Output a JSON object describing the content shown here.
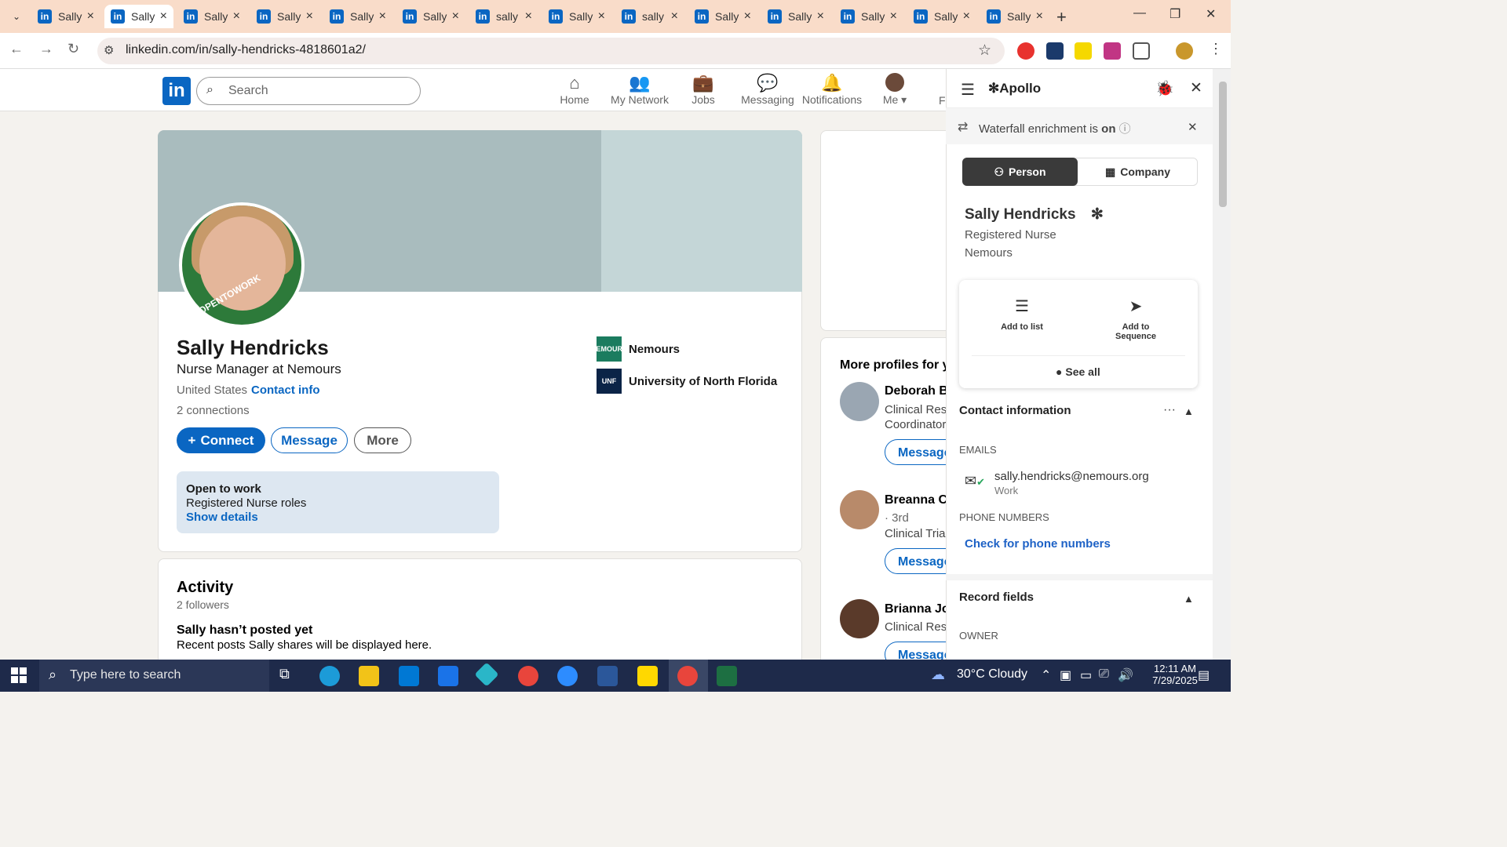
{
  "browser": {
    "tabs": [
      {
        "label": "Sally"
      },
      {
        "label": "Sally",
        "active": true
      },
      {
        "label": "Sally"
      },
      {
        "label": "Sally"
      },
      {
        "label": "Sally"
      },
      {
        "label": "Sally"
      },
      {
        "label": "sally"
      },
      {
        "label": "Sally"
      },
      {
        "label": "sally"
      },
      {
        "label": "Sally"
      },
      {
        "label": "Sally"
      },
      {
        "label": "Sally"
      },
      {
        "label": "Sally"
      },
      {
        "label": "Sally"
      }
    ],
    "url": "linkedin.com/in/sally-hendricks-4818601a2/",
    "colors": {
      "tabbar": "#f9dcc9",
      "linkedin_blue": "#0a66c2"
    }
  },
  "linkedin": {
    "logo": "in",
    "search_placeholder": "Search",
    "nav": [
      "Home",
      "My Network",
      "Jobs",
      "Messaging",
      "Notifications",
      "Me",
      "Fo"
    ],
    "profile": {
      "name": "Sally Hendricks",
      "headline": "Nurse Manager at Nemours",
      "location": "United States",
      "contact_info": "Contact info",
      "connections": "2 connections",
      "open_to_work_badge": "#OPENTOWORK",
      "buttons": {
        "connect": "Connect",
        "message": "Message",
        "more": "More"
      },
      "open_to_work": {
        "title": "Open to work",
        "roles": "Registered Nurse roles",
        "link": "Show details"
      },
      "orgs": [
        {
          "name": "Nemours",
          "logo_text": "NEMOURS"
        },
        {
          "name": "University of North Florida",
          "logo_text": "UNF"
        }
      ]
    },
    "activity": {
      "title": "Activity",
      "followers": "2 followers",
      "no_posts": "Sally hasn’t posted yet",
      "recent_posts": "Recent posts Sally shares will be displayed here."
    },
    "more_profiles": {
      "title": "More profiles for y",
      "items": [
        {
          "name": "Deborah B",
          "degree": "",
          "sub1": "Clinical Rese",
          "sub2": "Coordinator",
          "action": "Message"
        },
        {
          "name": "Breanna Ca",
          "degree": "· 3rd",
          "sub1": "Clinical Trials",
          "sub2": "",
          "action": "Message"
        },
        {
          "name": "Brianna Jo",
          "degree": "",
          "sub1": "Clinical Rese",
          "sub2": "",
          "action": "Message"
        }
      ]
    }
  },
  "apollo": {
    "brand": "Apollo",
    "waterfall_prefix": "Waterfall enrichment is",
    "waterfall_state": "on",
    "tabs": {
      "person": "Person",
      "company": "Company"
    },
    "person": {
      "name": "Sally Hendricks",
      "title": "Registered Nurse",
      "company": "Nemours"
    },
    "actions": {
      "add_to_list": "Add to list",
      "add_to_sequence_1": "Add to",
      "add_to_sequence_2": "Sequence",
      "see_all": "See all"
    },
    "contact_information": "Contact information",
    "emails_label": "EMAILS",
    "email": "sally.hendricks@nemours.org",
    "email_type": "Work",
    "phone_label": "PHONE NUMBERS",
    "check_phone": "Check for phone numbers",
    "record_fields": "Record fields",
    "owner_label": "OWNER"
  },
  "taskbar": {
    "search_placeholder": "Type here to search",
    "weather": "30°C  Cloudy",
    "time": "12:11 AM",
    "date": "7/29/2025"
  }
}
